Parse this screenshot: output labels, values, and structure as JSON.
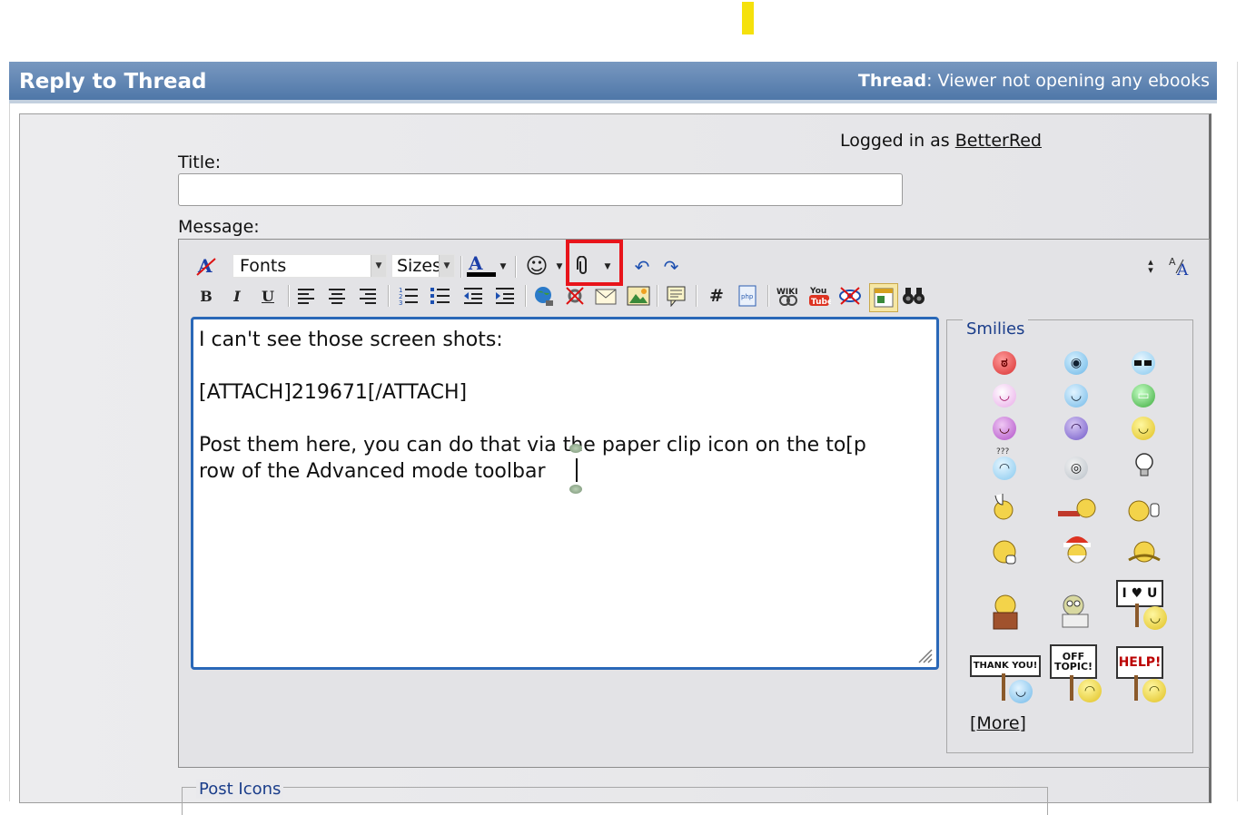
{
  "header": {
    "title": "Reply to Thread",
    "thread_label": "Thread",
    "thread_name": ": Viewer not opening any ebooks"
  },
  "login": {
    "prefix": "Logged in as ",
    "username": "BetterRed"
  },
  "form": {
    "title_label": "Title:",
    "title_value": "",
    "message_label": "Message:"
  },
  "toolbar": {
    "font_select": "Fonts",
    "size_select": "Sizes",
    "highlight_note": "attachment paper clip button highlighted"
  },
  "message": {
    "lines": [
      "I can't see those screen shots:",
      "",
      "[ATTACH]219671[/ATTACH]",
      "",
      "Post them here, you can do that via the paper clip icon on the to[p",
      "row of the Advanced mode toolbar"
    ]
  },
  "smilies": {
    "legend": "Smilies",
    "more": "[More]",
    "signs": {
      "iloveu": "I ♥ U",
      "thankyou": "THANK YOU!",
      "offtopic": "OFF TOPIC!",
      "help": "HELP!",
      "confused": "???"
    }
  },
  "post_icons": {
    "legend": "Post Icons"
  },
  "colors": {
    "header_bg": "#4f77a8",
    "editor_border": "#2a68b8",
    "highlight": "#e8141b"
  }
}
